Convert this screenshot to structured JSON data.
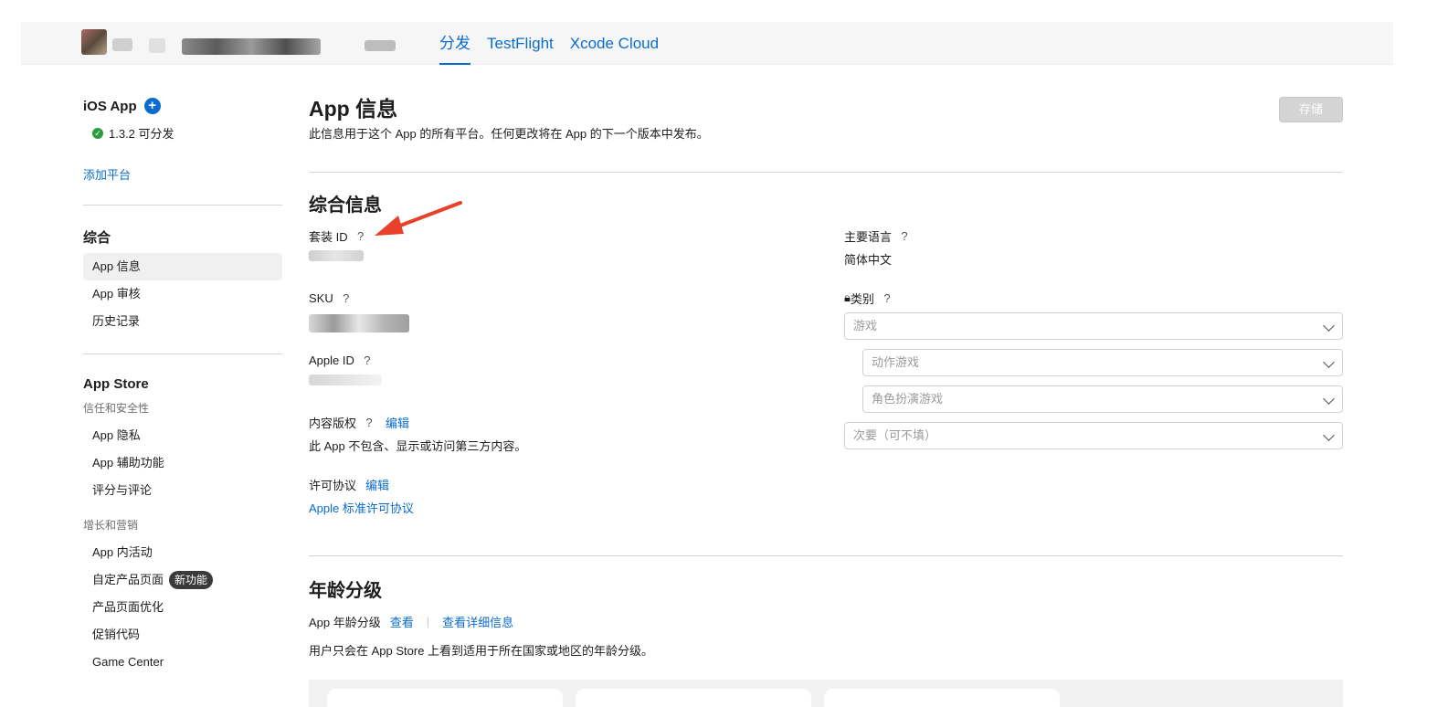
{
  "top_nav": {
    "tabs": [
      {
        "label": "分发",
        "active": true
      },
      {
        "label": "TestFlight",
        "active": false
      },
      {
        "label": "Xcode Cloud",
        "active": false
      }
    ]
  },
  "sidebar": {
    "platform_title": "iOS App",
    "version_status": "1.3.2 可分发",
    "add_platform": "添加平台",
    "general_section": "综合",
    "general_items": [
      "App 信息",
      "App 审核",
      "历史记录"
    ],
    "appstore_section": "App Store",
    "trust_sub": "信任和安全性",
    "trust_items": [
      "App 隐私",
      "App 辅助功能",
      "评分与评论"
    ],
    "growth_sub": "增长和营销",
    "growth_items": [
      "App 内活动",
      "自定产品页面",
      "产品页面优化",
      "促销代码",
      "Game Center"
    ],
    "new_badge": "新功能"
  },
  "main": {
    "title": "App 信息",
    "description": "此信息用于这个 App 的所有平台。任何更改将在 App 的下一个版本中发布。",
    "save_label": "存储",
    "general_title": "综合信息",
    "bundle_id_label": "套装 ID",
    "sku_label": "SKU",
    "apple_id_label": "Apple ID",
    "content_rights_label": "内容版权",
    "edit_label": "编辑",
    "content_rights_value": "此 App 不包含、显示或访问第三方内容。",
    "license_label": "许可协议",
    "license_link": "Apple 标准许可协议",
    "primary_lang_label": "主要语言",
    "primary_lang_value": "简体中文",
    "category_label": "类别",
    "category_primary": "游戏",
    "category_sub1": "动作游戏",
    "category_sub2": "角色扮演游戏",
    "category_secondary": "次要（可不填）",
    "help_glyph": "?",
    "age_title": "年龄分级",
    "age_label": "App 年龄分级",
    "age_view": "查看",
    "age_view_details": "查看详细信息",
    "age_desc": "用户只会在 App Store 上看到适用于所在国家或地区的年龄分级。"
  },
  "colors": {
    "accent": "#0a6cce",
    "annotation_arrow": "#e8402a",
    "status_ok": "#2a9d3e"
  }
}
